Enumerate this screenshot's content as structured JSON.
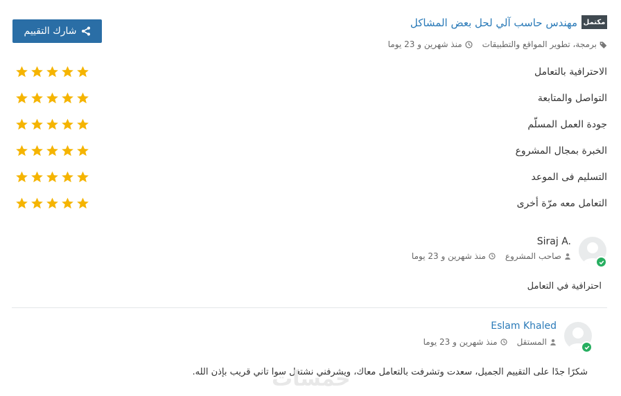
{
  "header": {
    "share_label": "شارك التقييم",
    "badge": "مكتمل",
    "title": "مهندس حاسب آلي لحل بعض المشاكل",
    "category": "برمجة، تطوير المواقع والتطبيقات",
    "time": "منذ شهرين و 23 يوما"
  },
  "criteria": [
    {
      "label": "الاحترافية بالتعامل",
      "rating": 5
    },
    {
      "label": "التواصل والمتابعة",
      "rating": 5
    },
    {
      "label": "جودة العمل المسلّم",
      "rating": 5
    },
    {
      "label": "الخبرة بمجال المشروع",
      "rating": 5
    },
    {
      "label": "التسليم فى الموعد",
      "rating": 5
    },
    {
      "label": "التعامل معه مرّة أخرى",
      "rating": 5
    }
  ],
  "review": {
    "name": "Siraj A.",
    "role": "صاحب المشروع",
    "time": "منذ شهرين و 23 يوما",
    "text": "احترافية في التعامل"
  },
  "reply": {
    "name": "Eslam Khaled",
    "role": "المستقل",
    "time": "منذ شهرين و 23 يوما",
    "text": "شكرًا جدًا على التقييم الجميل، سعدت وتشرفت بالتعامل معاك، ويشرفني نشتغل سوا تاني قريب بإذن الله."
  },
  "watermark": "خمسات",
  "colors": {
    "accent": "#2a6ea6",
    "link": "#2a7ab8",
    "star": "#f5b400",
    "badge": "#3f4950",
    "verified": "#27ae60"
  }
}
